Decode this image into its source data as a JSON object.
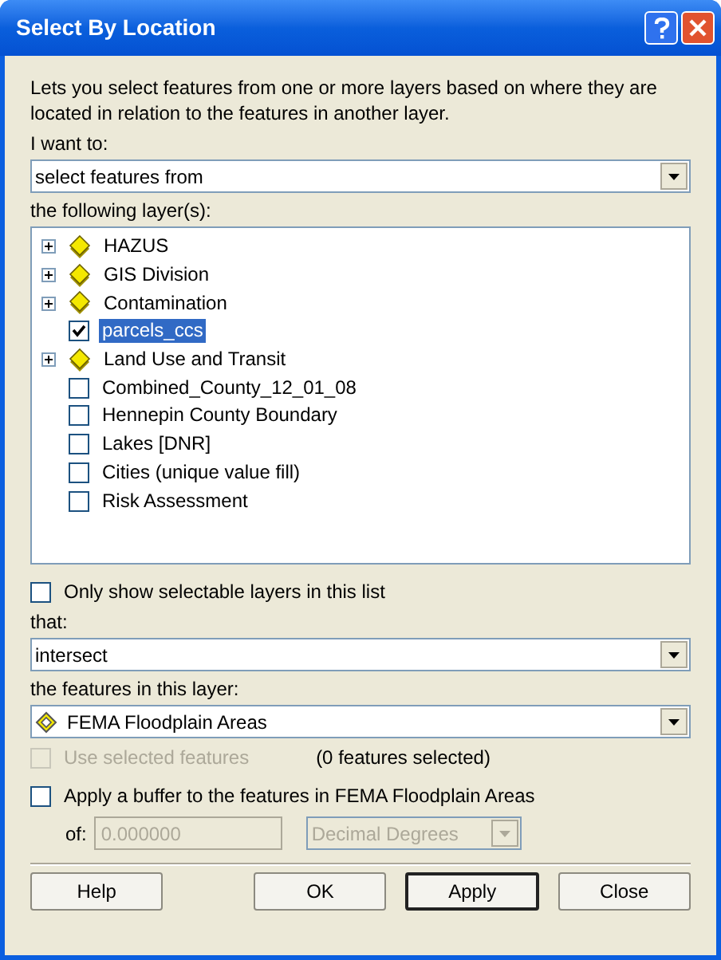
{
  "window": {
    "title": "Select By Location"
  },
  "description": "Lets you select features from one or more layers based on where they are located in relation to the features in another layer.",
  "method": {
    "label": "I want to:",
    "value": "select features from"
  },
  "layers": {
    "label": "the following layer(s):",
    "items": [
      {
        "kind": "group",
        "label": "HAZUS",
        "expanded": false,
        "selected": false
      },
      {
        "kind": "group",
        "label": "GIS Division",
        "expanded": false,
        "selected": false
      },
      {
        "kind": "group",
        "label": "Contamination",
        "expanded": false,
        "selected": false
      },
      {
        "kind": "layer",
        "label": "parcels_ccs",
        "checked": true,
        "selected": true
      },
      {
        "kind": "group",
        "label": "Land Use and Transit",
        "expanded": false,
        "selected": false
      },
      {
        "kind": "layer",
        "label": "Combined_County_12_01_08",
        "checked": false,
        "selected": false
      },
      {
        "kind": "layer",
        "label": "Hennepin County Boundary",
        "checked": false,
        "selected": false
      },
      {
        "kind": "layer",
        "label": "Lakes [DNR]",
        "checked": false,
        "selected": false
      },
      {
        "kind": "layer",
        "label": "Cities (unique value fill)",
        "checked": false,
        "selected": false
      },
      {
        "kind": "layer",
        "label": "Risk Assessment",
        "checked": false,
        "selected": false
      }
    ]
  },
  "only_selectable": {
    "label": "Only show selectable layers in this list",
    "checked": false
  },
  "relation": {
    "label": "that:",
    "value": "intersect"
  },
  "source_layer": {
    "label": "the features in this layer:",
    "value": "FEMA Floodplain Areas"
  },
  "use_selected": {
    "label": "Use selected features",
    "checked": false,
    "disabled": true,
    "count": "(0 features selected)"
  },
  "buffer": {
    "label": "Apply a buffer to the features in FEMA Floodplain Areas",
    "checked": false,
    "of_label": "of:",
    "distance": "0.000000",
    "units": "Decimal Degrees",
    "disabled": true
  },
  "buttons": [
    {
      "label": "Help",
      "default": false
    },
    {
      "label": "OK",
      "default": false
    },
    {
      "label": "Apply",
      "default": true
    },
    {
      "label": "Close",
      "default": false
    }
  ]
}
